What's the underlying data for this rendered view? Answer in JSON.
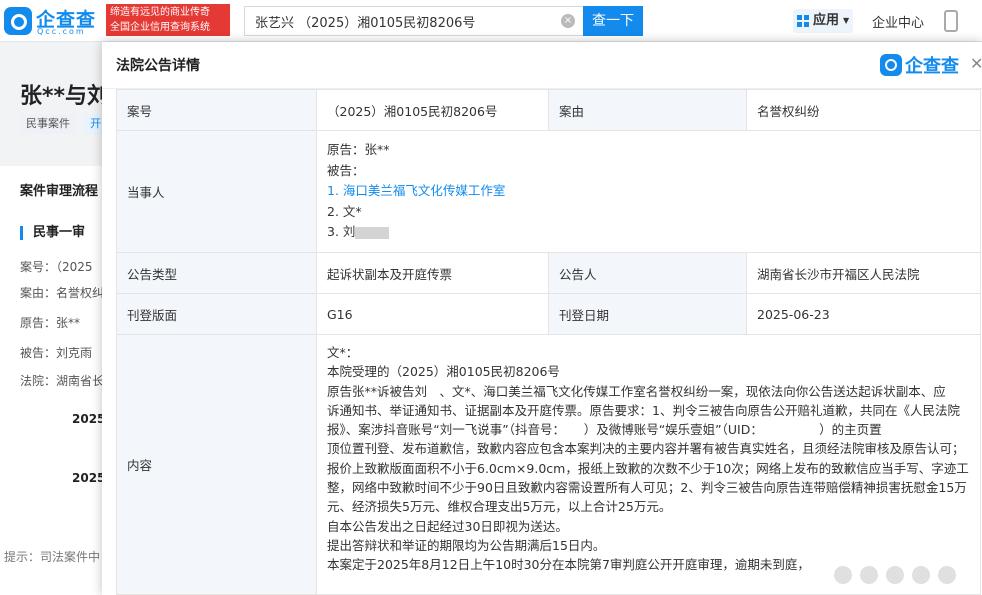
{
  "brand": {
    "name": "企查查",
    "sub": "Qcc.com",
    "accent": "#128bed"
  },
  "ad": {
    "line1": "缔造有远见的商业传奇",
    "line2": "全国企业信用查询系统"
  },
  "search": {
    "value": "张艺兴 （2025）湘0105民初8206号",
    "button": "查一下"
  },
  "nav": {
    "apps": "应用",
    "enterprise": "企业中心"
  },
  "background": {
    "title": "张**与刘",
    "tags": [
      "民事案件",
      "开"
    ],
    "flow": "案件审理流程",
    "section": "民事一审",
    "lines": [
      "案号：（2025",
      "案由：名誉权纠",
      "原告：张**",
      "被告：刘克雨",
      "法院：湖南省长"
    ],
    "dates": [
      "2025",
      "2025"
    ],
    "tip": "提示：司法案件中"
  },
  "modal": {
    "title": "法院公告详情",
    "logo": "企查查",
    "rows": {
      "case_no_label": "案号",
      "case_no": "（2025）湘0105民初8206号",
      "cause_label": "案由",
      "cause": "名誉权纠纷",
      "parties_label": "当事人",
      "plaintiff": "原告：张**",
      "defendant_label": "被告：",
      "defendant1": "1. 海口美兰福飞文化传媒工作室",
      "defendant2": "2. 文*",
      "defendant3": "3. 刘",
      "type_label": "公告类型",
      "type": "起诉状副本及开庭传票",
      "announcer_label": "公告人",
      "announcer": "湖南省长沙市开福区人民法院",
      "page_label": "刊登版面",
      "page": "G16",
      "date_label": "刊登日期",
      "date": "2025-06-23",
      "content_label": "内容",
      "content": [
        "文*：",
        "本院受理的（2025）湘0105民初8206号",
        "原告张**诉被告刘　、文*、海口美兰福飞文化传媒工作室名誉权纠纷一案，现依法向你公告送达起诉状副本、应",
        "诉通知书、举证通知书、证据副本及开庭传票。原告要求：1、判令三被告向原告公开赔礼道歉，共同在《人民法院",
        "报》、案涉抖音账号“刘一飞说事”（抖音号：　　）及微博账号“娱乐壹姐”（UID：　　　　　）的主页置",
        "顶位置刊登、发布道歉信，致歉内容应包含本案判决的主要内容并署有被告真实姓名，且须经法院审核及原告认可；",
        "报价上致歉版面面积不小于6.0cm×9.0cm，报纸上致歉的次数不少于10次；网络上发布的致歉信应当手写、字迹工",
        "整，网络中致歉时间不少于90日且致歉内容需设置所有人可见；2、判令三被告向原告连带赔偿精神损害抚慰金15万",
        "元、经济损失5万元、维权合理支出5万元，以上合计25万元。",
        "自本公告发出之日起经过30日即视为送达。",
        "提出答辩状和举证的期限均为公告期满后15日内。",
        "本案定于2025年8月12日上午10时30分在本院第7审判庭公开开庭审理，逾期未到庭，"
      ]
    }
  }
}
